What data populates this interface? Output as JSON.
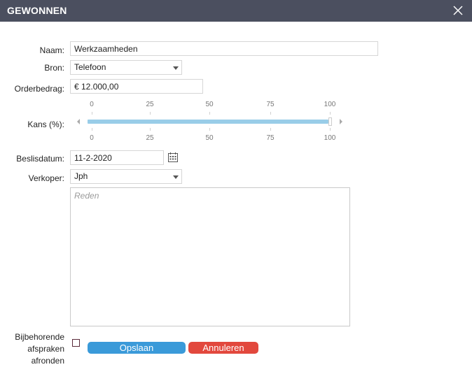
{
  "dialog": {
    "title": "GEWONNEN",
    "close_icon": "close-icon"
  },
  "form": {
    "name": {
      "label": "Naam:",
      "value": "Werkzaamheden"
    },
    "source": {
      "label": "Bron:",
      "value": "Telefoon"
    },
    "order_amount": {
      "label": "Orderbedrag:",
      "value": "€ 12.000,00"
    },
    "chance": {
      "label": "Kans (%):",
      "ticks": [
        "0",
        "25",
        "50",
        "75",
        "100"
      ],
      "value_percent": 100,
      "track_color": "#99cde8"
    },
    "decision_date": {
      "label": "Beslisdatum:",
      "value": "11-2-2020",
      "icon": "calendar-icon"
    },
    "seller": {
      "label": "Verkoper:",
      "value": "Jph"
    },
    "reason": {
      "placeholder": "Reden",
      "value": ""
    },
    "complete_appointments": {
      "label_line1": "Bijbehorende",
      "label_line2": "afspraken",
      "label_line3": "afronden",
      "checked": false
    }
  },
  "buttons": {
    "save": {
      "label": "Opslaan",
      "color": "#3a9ad9"
    },
    "cancel": {
      "label": "Annuleren",
      "color": "#e2483d"
    }
  },
  "colors": {
    "titlebar": "#4b4f5f"
  }
}
